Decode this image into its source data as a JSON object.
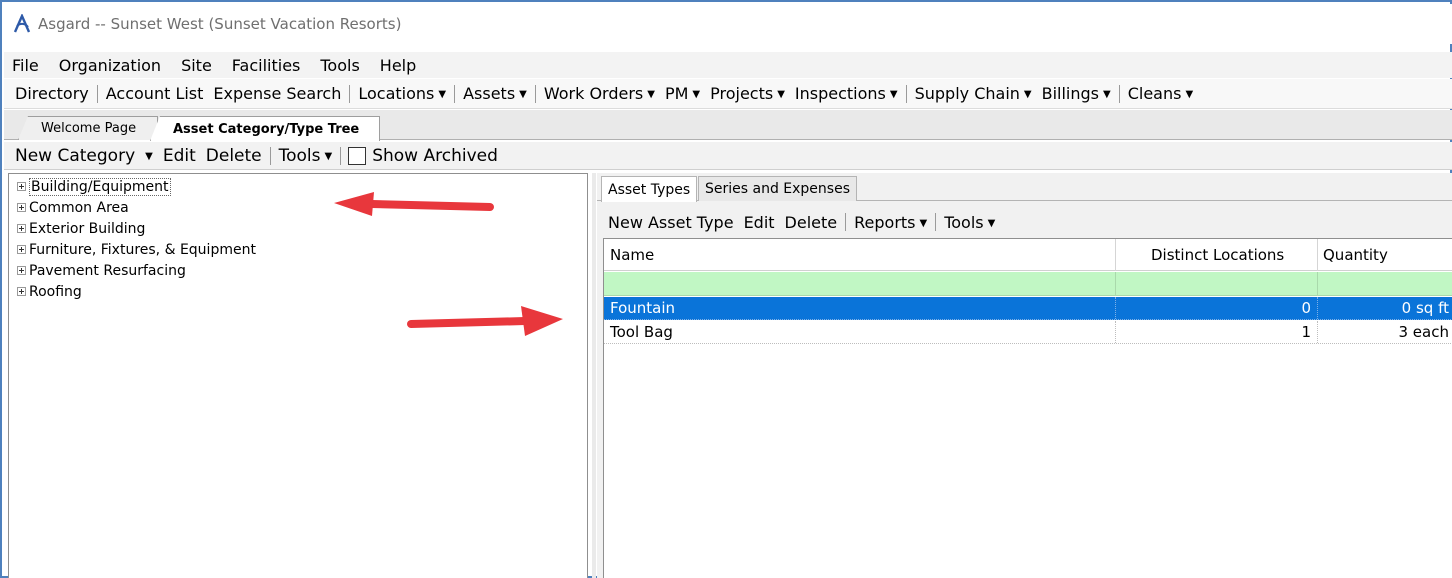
{
  "window": {
    "title": "Asgard -- Sunset West (Sunset Vacation Resorts)",
    "icon": "asgard-logo-icon"
  },
  "menu": [
    "File",
    "Organization",
    "Site",
    "Facilities",
    "Tools",
    "Help"
  ],
  "nav": {
    "directory": "Directory",
    "account_list": "Account List",
    "expense_search": "Expense Search",
    "locations": "Locations",
    "assets": "Assets",
    "work_orders": "Work Orders",
    "pm": "PM",
    "projects": "Projects",
    "inspections": "Inspections",
    "supply_chain": "Supply Chain",
    "billings": "Billings",
    "cleans": "Cleans"
  },
  "doc_tabs": [
    {
      "label": "Welcome Page",
      "active": false
    },
    {
      "label": "Asset Category/Type Tree",
      "active": true
    }
  ],
  "page_toolbar": {
    "new_category": "New Category",
    "edit": "Edit",
    "delete": "Delete",
    "tools": "Tools",
    "show_archived": "Show Archived",
    "show_archived_checked": false
  },
  "tree": [
    "Building/Equipment",
    "Common Area",
    "Exterior Building",
    "Furniture, Fixtures, & Equipment",
    "Pavement Resurfacing",
    "Roofing"
  ],
  "sub_tabs": [
    {
      "label": "Asset Types",
      "active": true
    },
    {
      "label": "Series and Expenses",
      "active": false
    }
  ],
  "grid_toolbar": {
    "new_asset_type": "New Asset Type",
    "edit": "Edit",
    "delete": "Delete",
    "reports": "Reports",
    "tools": "Tools"
  },
  "grid": {
    "columns": [
      "Name",
      "Distinct Locations",
      "Quantity"
    ],
    "rows": [
      {
        "name": "Fountain",
        "locations": "0",
        "quantity": "0 sq ft",
        "selected": true
      },
      {
        "name": "Tool Bag",
        "locations": "1",
        "quantity": "3 each",
        "selected": false
      }
    ]
  },
  "colors": {
    "frame_border": "#4f81bd",
    "filter_row": "#c1f7c4",
    "selection": "#0a74d9",
    "annotation_arrow": "#e8373c"
  }
}
